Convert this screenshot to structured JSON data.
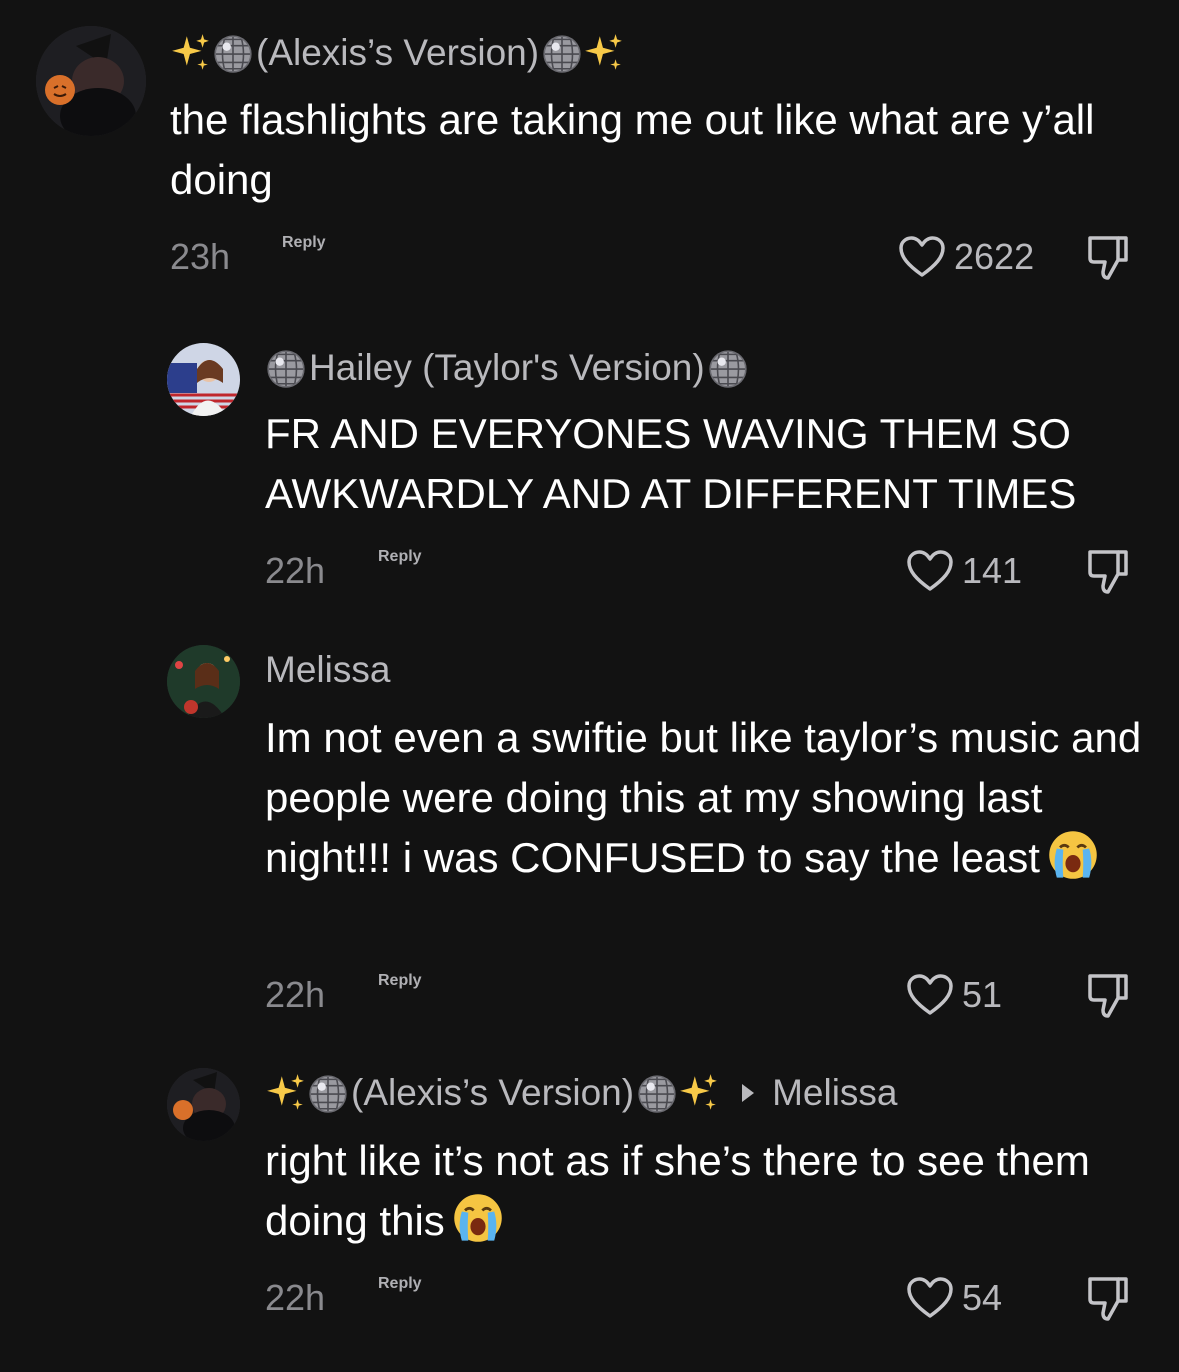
{
  "colors": {
    "background": "#121212",
    "username": "#b9b9bd",
    "text": "#ffffff",
    "meta": "#8a8a8e"
  },
  "comments": [
    {
      "username": "(Alexis’s Version)",
      "prefix_icons": [
        "sparkles-icon",
        "disco-ball-icon"
      ],
      "suffix_icons": [
        "disco-ball-icon",
        "sparkles-icon"
      ],
      "text": "the flashlights are taking me out like what are y’all doing",
      "time": "23h",
      "reply_label": "Reply",
      "likes": "2622"
    },
    {
      "username": "Hailey (Taylor's Version)",
      "prefix_icons": [
        "disco-ball-icon"
      ],
      "suffix_icons": [
        "disco-ball-icon"
      ],
      "text": "FR AND EVERYONES WAVING THEM SO AWKWARDLY AND AT DIFFERENT TIMES",
      "time": "22h",
      "reply_label": "Reply",
      "likes": "141"
    },
    {
      "username": "Melissa",
      "text": "Im not even a swiftie but like taylor’s music and people were doing this at my showing last night!!! i was CONFUSED to say the least",
      "trailing_icon": "loudly-crying-face-icon",
      "time": "22h",
      "reply_label": "Reply",
      "likes": "51"
    },
    {
      "username": "(Alexis’s Version)",
      "prefix_icons": [
        "sparkles-icon",
        "disco-ball-icon"
      ],
      "suffix_icons": [
        "disco-ball-icon",
        "sparkles-icon"
      ],
      "reply_to": "Melissa",
      "text": "right like it’s not as if she’s there to see them doing this",
      "trailing_icon": "loudly-crying-face-icon",
      "time": "22h",
      "reply_label": "Reply",
      "likes": "54"
    }
  ]
}
